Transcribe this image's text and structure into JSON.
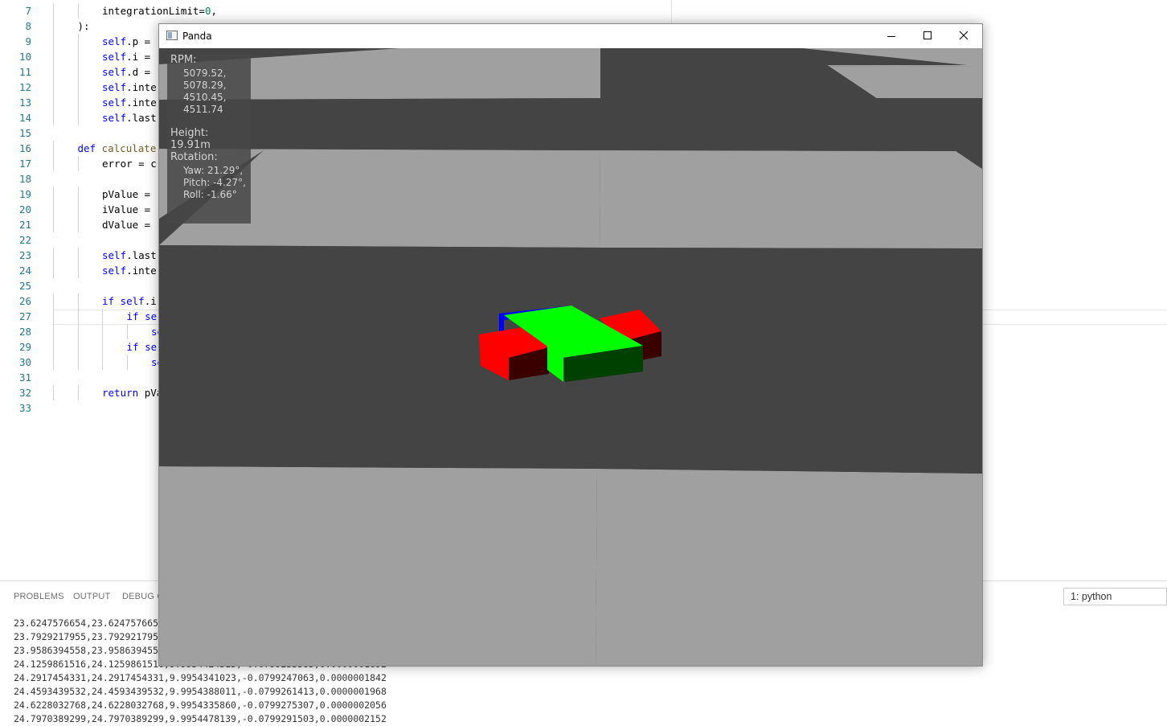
{
  "editor": {
    "lines": [
      {
        "n": "7",
        "indent": 2,
        "parts": [
          {
            "t": "integrationLimit=",
            "c": ""
          },
          {
            "t": "0",
            "c": "num"
          },
          {
            "t": ",",
            "c": ""
          }
        ]
      },
      {
        "n": "8",
        "indent": 1,
        "parts": [
          {
            "t": "):",
            "c": ""
          }
        ]
      },
      {
        "n": "9",
        "indent": 2,
        "parts": [
          {
            "t": "self",
            "c": "kw"
          },
          {
            "t": ".p = ",
            "c": ""
          }
        ]
      },
      {
        "n": "10",
        "indent": 2,
        "parts": [
          {
            "t": "self",
            "c": "kw"
          },
          {
            "t": ".i = ",
            "c": ""
          }
        ]
      },
      {
        "n": "11",
        "indent": 2,
        "parts": [
          {
            "t": "self",
            "c": "kw"
          },
          {
            "t": ".d = ",
            "c": ""
          }
        ]
      },
      {
        "n": "12",
        "indent": 2,
        "parts": [
          {
            "t": "self",
            "c": "kw"
          },
          {
            "t": ".inte",
            "c": ""
          }
        ]
      },
      {
        "n": "13",
        "indent": 2,
        "parts": [
          {
            "t": "self",
            "c": "kw"
          },
          {
            "t": ".inte",
            "c": ""
          }
        ]
      },
      {
        "n": "14",
        "indent": 2,
        "parts": [
          {
            "t": "self",
            "c": "kw"
          },
          {
            "t": ".last",
            "c": ""
          }
        ]
      },
      {
        "n": "15",
        "indent": 0,
        "parts": []
      },
      {
        "n": "16",
        "indent": 1,
        "parts": [
          {
            "t": "def ",
            "c": "kw"
          },
          {
            "t": "calculate",
            "c": "fn"
          }
        ]
      },
      {
        "n": "17",
        "indent": 2,
        "parts": [
          {
            "t": "error = c",
            "c": ""
          }
        ]
      },
      {
        "n": "18",
        "indent": 0,
        "parts": []
      },
      {
        "n": "19",
        "indent": 2,
        "parts": [
          {
            "t": "pValue = ",
            "c": ""
          }
        ]
      },
      {
        "n": "20",
        "indent": 2,
        "parts": [
          {
            "t": "iValue = ",
            "c": ""
          }
        ]
      },
      {
        "n": "21",
        "indent": 2,
        "parts": [
          {
            "t": "dValue = ",
            "c": ""
          }
        ]
      },
      {
        "n": "22",
        "indent": 0,
        "parts": []
      },
      {
        "n": "23",
        "indent": 2,
        "parts": [
          {
            "t": "self",
            "c": "kw"
          },
          {
            "t": ".last",
            "c": ""
          }
        ]
      },
      {
        "n": "24",
        "indent": 2,
        "parts": [
          {
            "t": "self",
            "c": "kw"
          },
          {
            "t": ".inte",
            "c": ""
          }
        ]
      },
      {
        "n": "25",
        "indent": 0,
        "parts": []
      },
      {
        "n": "26",
        "indent": 2,
        "parts": [
          {
            "t": "if ",
            "c": "kw"
          },
          {
            "t": "self",
            "c": "kw"
          },
          {
            "t": ".i",
            "c": ""
          }
        ]
      },
      {
        "n": "27",
        "indent": 3,
        "parts": [
          {
            "t": "if ",
            "c": "kw"
          },
          {
            "t": "se",
            "c": "kw"
          }
        ]
      },
      {
        "n": "28",
        "indent": 4,
        "parts": [
          {
            "t": "se",
            "c": "kw"
          }
        ]
      },
      {
        "n": "29",
        "indent": 3,
        "parts": [
          {
            "t": "if ",
            "c": "kw"
          },
          {
            "t": "se",
            "c": "kw"
          }
        ]
      },
      {
        "n": "30",
        "indent": 4,
        "parts": [
          {
            "t": "se",
            "c": "kw"
          }
        ]
      },
      {
        "n": "31",
        "indent": 0,
        "parts": []
      },
      {
        "n": "32",
        "indent": 2,
        "parts": [
          {
            "t": "return ",
            "c": "kw"
          },
          {
            "t": "pVa",
            "c": ""
          }
        ]
      },
      {
        "n": "33",
        "indent": 0,
        "parts": []
      }
    ]
  },
  "panel": {
    "tabs": [
      "PROBLEMS",
      "OUTPUT",
      "DEBUG C"
    ],
    "terminal_select": "1: python",
    "output_lines": [
      "23.6247576654,23.624757665",
      "23.7929217955,23.792921795",
      "23.9586394558,23.958639455",
      "24.1259861516,24.1259861516,9.9954424515,-0.0799233585,0.0000001692",
      "24.2917454331,24.2917454331,9.9954341023,-0.0799247063,0.0000001842",
      "24.4593439532,24.4593439532,9.9954388011,-0.0799261413,0.0000001968",
      "24.6228032768,24.6228032768,9.9954335860,-0.0799275307,0.0000002056",
      "24.7970389299,24.7970389299,9.9954478139,-0.0799291503,0.0000002152"
    ]
  },
  "panda_window": {
    "title": "Panda",
    "hud": {
      "rpm_label": "RPM:",
      "rpm_values": [
        "5079.52,",
        "5078.29,",
        "4510.45,",
        "4511.74"
      ],
      "height": "Height: 19.91m",
      "rotation_label": "Rotation:",
      "yaw": "Yaw: 21.29°,",
      "pitch": "Pitch: -4.27°,",
      "roll": "Roll: -1.66°"
    }
  },
  "colors": {
    "floor_dark": "#444444",
    "floor_light": "#a0a0a0",
    "drone_body": "#00ff00",
    "drone_body_side": "#004000",
    "drone_rotor": "#ff0000",
    "drone_rotor_side": "#3a0000",
    "drone_axis": "#0000ff"
  },
  "icons": [
    "minimize-icon",
    "maximize-icon",
    "close-icon",
    "app-icon"
  ]
}
